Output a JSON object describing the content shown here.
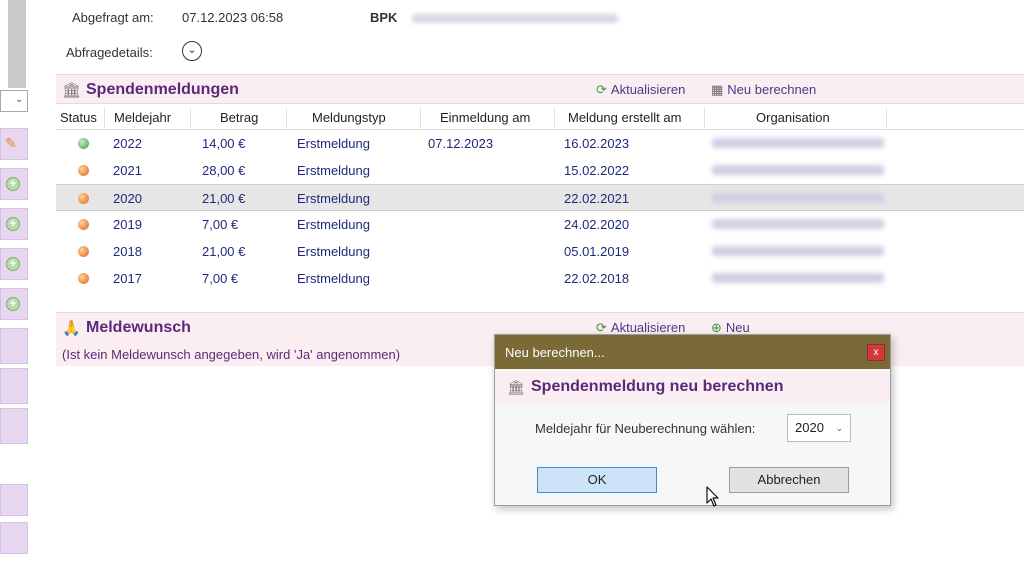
{
  "header": {
    "queried_label": "Abgefragt am:",
    "queried_value": "07.12.2023 06:58",
    "bpk_label": "BPK",
    "details_label": "Abfragedetails:"
  },
  "spenden": {
    "title": "Spendenmeldungen",
    "refresh_label": "Aktualisieren",
    "recalc_label": "Neu berechnen",
    "columns": [
      "Status",
      "Meldejahr",
      "Betrag",
      "Meldungstyp",
      "Einmeldung am",
      "Meldung erstellt am",
      "Organisation"
    ],
    "rows": [
      {
        "status": "green",
        "year": "2022",
        "amount": "14,00 €",
        "type": "Erstmeldung",
        "einmeldung": "07.12.2023",
        "erstellt": "16.02.2023"
      },
      {
        "status": "orange",
        "year": "2021",
        "amount": "28,00 €",
        "type": "Erstmeldung",
        "einmeldung": "",
        "erstellt": "15.02.2022"
      },
      {
        "status": "orange",
        "year": "2020",
        "amount": "21,00 €",
        "type": "Erstmeldung",
        "einmeldung": "",
        "erstellt": "22.02.2021"
      },
      {
        "status": "orange",
        "year": "2019",
        "amount": "7,00 €",
        "type": "Erstmeldung",
        "einmeldung": "",
        "erstellt": "24.02.2020"
      },
      {
        "status": "orange",
        "year": "2018",
        "amount": "21,00 €",
        "type": "Erstmeldung",
        "einmeldung": "",
        "erstellt": "05.01.2019"
      },
      {
        "status": "orange",
        "year": "2017",
        "amount": "7,00 €",
        "type": "Erstmeldung",
        "einmeldung": "",
        "erstellt": "22.02.2018"
      }
    ]
  },
  "meldewunsch": {
    "title": "Meldewunsch",
    "note": "(Ist kein Meldewunsch angegeben, wird 'Ja' angenommen)",
    "refresh_label": "Aktualisieren",
    "new_label": "Neu"
  },
  "dialog": {
    "window_title": "Neu berechnen...",
    "close_label": "x",
    "header": "Spendenmeldung neu berechnen",
    "field_label": "Meldejahr für Neuberechnung wählen:",
    "selected_year": "2020",
    "ok_label": "OK",
    "cancel_label": "Abbrechen"
  },
  "colors": {
    "accent_purple": "#5a2a7a",
    "section_bg": "#fbeef2",
    "dialog_titlebar": "#7a6a38",
    "ok_button": "#cce4f7"
  }
}
